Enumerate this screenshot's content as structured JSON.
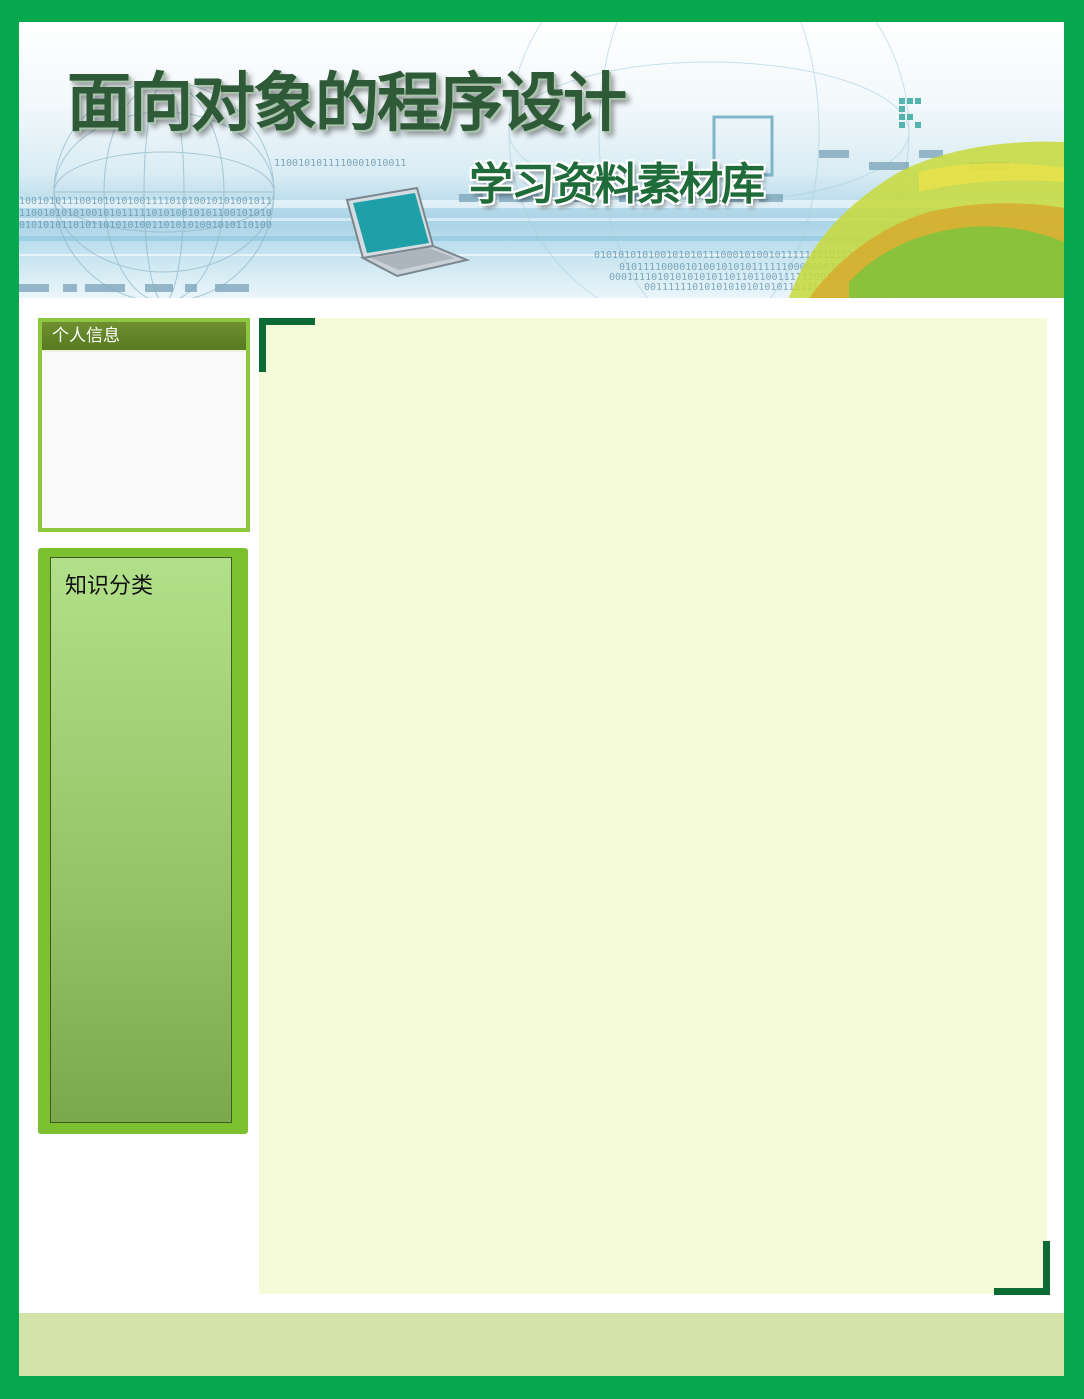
{
  "banner": {
    "title": "面向对象的程序设计",
    "subtitle": "学习资料素材库"
  },
  "sidebar": {
    "personal_info_title": "个人信息",
    "category_title": "知识分类"
  },
  "colors": {
    "outer_frame": "#06a84e",
    "panel_border": "#8dc63f",
    "panel_header": "#587a22",
    "content_bg": "#f5fbd8",
    "corner_accent": "#0c6a35",
    "footer_bg": "#d3e4ab"
  }
}
